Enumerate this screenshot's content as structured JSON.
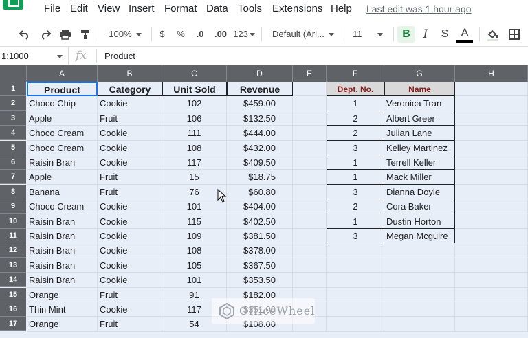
{
  "menu": {
    "items": [
      "File",
      "Edit",
      "View",
      "Insert",
      "Format",
      "Data",
      "Tools",
      "Extensions",
      "Help"
    ],
    "last_edit": "Last edit was 1 hour ago"
  },
  "toolbar": {
    "zoom": "100%",
    "currency": "$",
    "percent": "%",
    "decimal_decrease": ".0",
    "decimal_increase": ".00",
    "more_formats": "123",
    "font": "Default (Ari...",
    "font_size": "11",
    "bold": "B",
    "italic": "I",
    "strike": "S",
    "text_color": "A"
  },
  "formula_bar": {
    "name_box": "1:1000",
    "fx": "fx",
    "value": "Product"
  },
  "columns": [
    "A",
    "B",
    "C",
    "D",
    "E",
    "F",
    "G",
    "H"
  ],
  "rows": [
    "1",
    "2",
    "3",
    "4",
    "5",
    "6",
    "7",
    "8",
    "9",
    "10",
    "11",
    "12",
    "13",
    "14",
    "15",
    "16",
    "17"
  ],
  "table1": {
    "headers": [
      "Product",
      "Category",
      "Unit Sold",
      "Revenue"
    ],
    "rows": [
      [
        "Choco Chip",
        "Cookie",
        "102",
        "$459.00"
      ],
      [
        "Apple",
        "Fruit",
        "106",
        "$132.50"
      ],
      [
        "Choco Cream",
        "Cookie",
        "111",
        "$444.00"
      ],
      [
        "Choco Cream",
        "Cookie",
        "108",
        "$432.00"
      ],
      [
        "Raisin Bran",
        "Cookie",
        "117",
        "$409.50"
      ],
      [
        "Apple",
        "Fruit",
        "15",
        "$18.75"
      ],
      [
        "Banana",
        "Fruit",
        "76",
        "$60.80"
      ],
      [
        "Choco Cream",
        "Cookie",
        "101",
        "$404.00"
      ],
      [
        "Raisin Bran",
        "Cookie",
        "115",
        "$402.50"
      ],
      [
        "Raisin Bran",
        "Cookie",
        "109",
        "$381.50"
      ],
      [
        "Raisin Bran",
        "Cookie",
        "108",
        "$378.00"
      ],
      [
        "Raisin Bran",
        "Cookie",
        "105",
        "$367.50"
      ],
      [
        "Raisin Bran",
        "Cookie",
        "101",
        "$353.50"
      ],
      [
        "Orange",
        "Fruit",
        "91",
        "$182.00"
      ],
      [
        "Thin Mint",
        "Cookie",
        "117",
        "$351.00"
      ],
      [
        "Orange",
        "Fruit",
        "54",
        "$108.00"
      ]
    ]
  },
  "table2": {
    "headers": [
      "Dept. No.",
      "Name"
    ],
    "rows": [
      [
        "1",
        "Veronica Tran"
      ],
      [
        "2",
        "Albert Greer"
      ],
      [
        "2",
        "Julian Lane"
      ],
      [
        "3",
        "Kelley Martinez"
      ],
      [
        "1",
        "Terrell Keller"
      ],
      [
        "1",
        "Mack Miller"
      ],
      [
        "3",
        "Dianna Doyle"
      ],
      [
        "2",
        "Cora Baker"
      ],
      [
        "1",
        "Dustin Horton"
      ],
      [
        "3",
        "Megan Mcguire"
      ]
    ]
  },
  "watermark": "OfficeWheel",
  "colors": {
    "header_bg": "#5f6368",
    "grid_bg": "#e8eef8",
    "selection": "#1a73e8",
    "name_header_text": "#8b1a1a",
    "logo_green": "#0f9d58"
  },
  "icons": [
    "undo-icon",
    "redo-icon",
    "print-icon",
    "paint-format-icon",
    "fill-color-icon",
    "borders-icon",
    "mouse-cursor-icon"
  ]
}
